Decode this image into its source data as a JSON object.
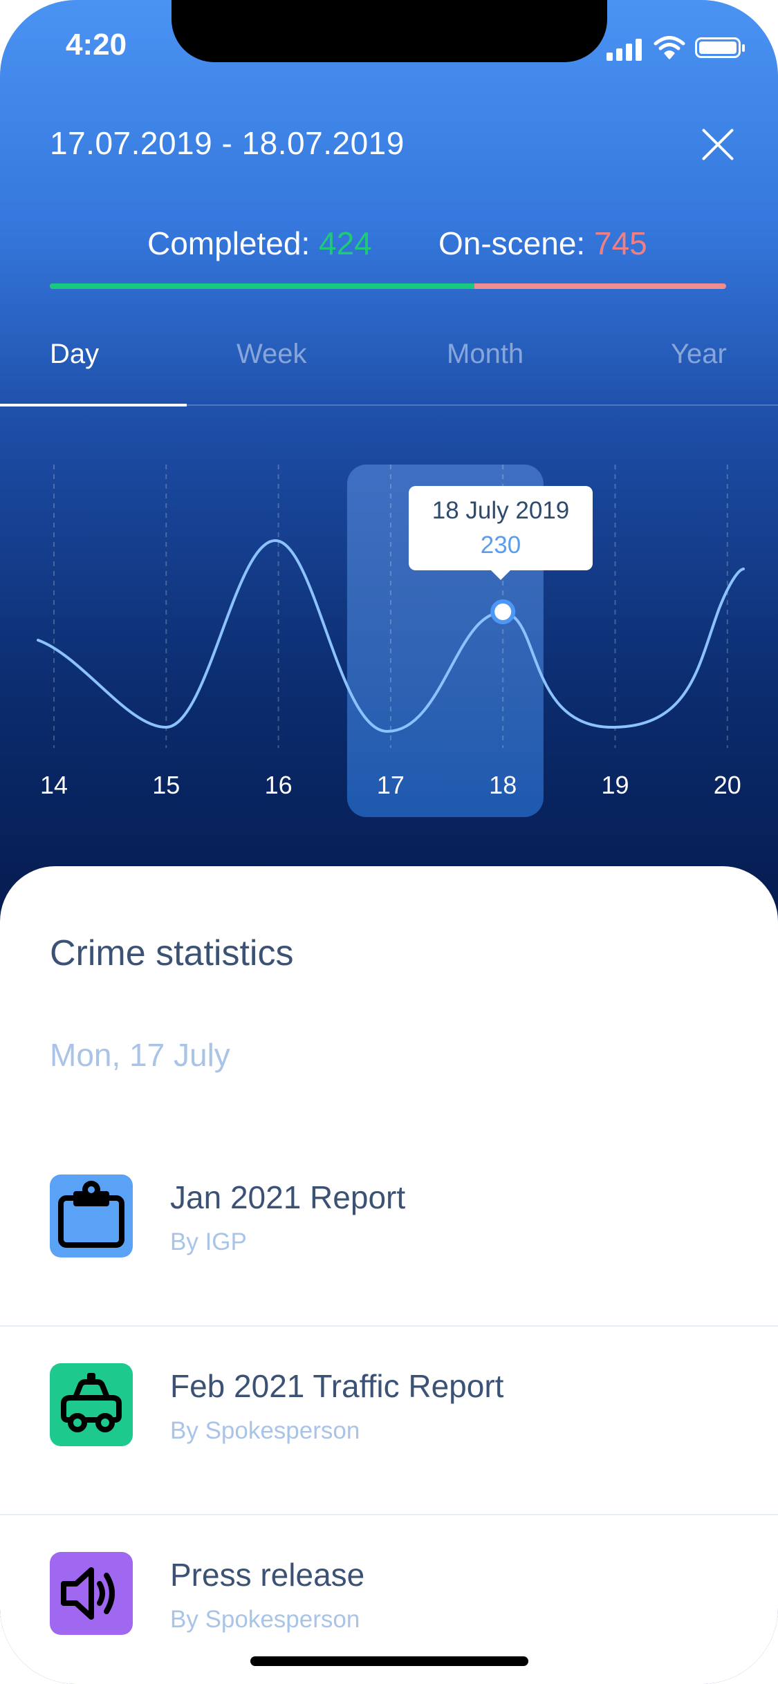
{
  "status_bar": {
    "time": "4:20"
  },
  "header": {
    "date_range": "17.07.2019 - 18.07.2019",
    "completed_label": "Completed: ",
    "completed_value": "424",
    "onscene_label": "On-scene: ",
    "onscene_value": "745",
    "progress_completed_fraction": 0.628
  },
  "tabs": [
    {
      "label": "Day",
      "active": true
    },
    {
      "label": "Week",
      "active": false
    },
    {
      "label": "Month",
      "active": false
    },
    {
      "label": "Year",
      "active": false
    }
  ],
  "tooltip": {
    "date": "18 July 2019",
    "value": "230"
  },
  "chart_data": {
    "type": "line",
    "x": [
      14,
      15,
      16,
      17,
      18,
      19,
      20
    ],
    "x_tick_labels": [
      "14",
      "15",
      "16",
      "17",
      "18",
      "19",
      "20"
    ],
    "highlight_category": "17",
    "selected_point": {
      "x": 18,
      "label": "18 July 2019",
      "value": 230
    },
    "grid": "vertical-dashed",
    "colors": {
      "line": "#8cc2ff",
      "highlight": "#1f5cb3"
    }
  },
  "sheet": {
    "title": "Crime statistics",
    "date": "Mon, 17 July",
    "items": [
      {
        "title": "Jan 2021 Report",
        "subtitle": "By  IGP",
        "icon": "clipboard-icon",
        "color": "#5aa2f6"
      },
      {
        "title": "Feb 2021 Traffic Report",
        "subtitle": "By Spokesperson",
        "icon": "car-icon",
        "color": "#1dc98c"
      },
      {
        "title": "Press release",
        "subtitle": "By Spokesperson",
        "icon": "speaker-icon",
        "color": "#a067f0"
      }
    ]
  }
}
